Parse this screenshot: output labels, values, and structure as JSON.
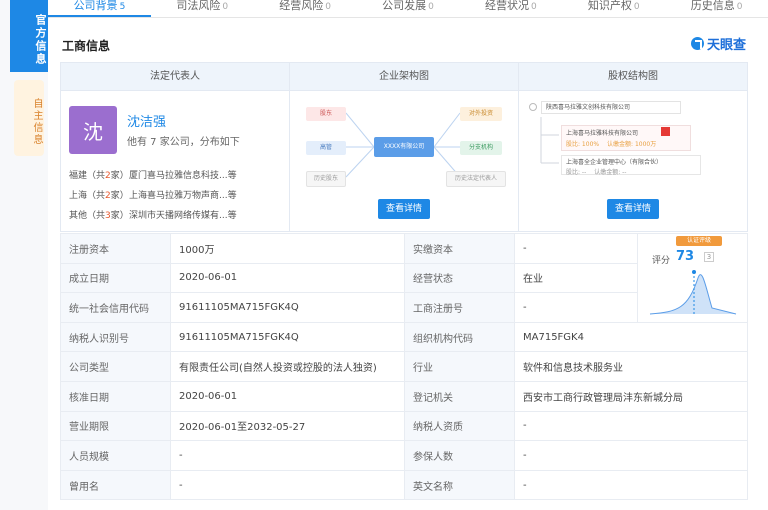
{
  "vtabs": {
    "official": "官方信息",
    "self": "自主信息"
  },
  "tabs": [
    {
      "label": "公司背景",
      "count": "5"
    },
    {
      "label": "司法风险",
      "count": "0"
    },
    {
      "label": "经营风险",
      "count": "0"
    },
    {
      "label": "公司发展",
      "count": "0"
    },
    {
      "label": "经营状况",
      "count": "0"
    },
    {
      "label": "知识产权",
      "count": "0"
    },
    {
      "label": "历史信息",
      "count": "0"
    }
  ],
  "section_title": "工商信息",
  "brand": "天眼查",
  "panel": {
    "headers": [
      "法定代表人",
      "企业架构图",
      "股权结构图"
    ],
    "legal": {
      "avatar_char": "沈",
      "name": "沈洁强",
      "summary": "他有 7 家公司，分布如下",
      "regions": [
        {
          "region": "福建",
          "count_prefix": "（共",
          "count": "2",
          "count_suffix": "家）",
          "company": "厦门喜马拉雅信息科技...等"
        },
        {
          "region": "上海",
          "count_prefix": "（共",
          "count": "2",
          "count_suffix": "家）",
          "company": "上海喜马拉雅万物声商...等"
        },
        {
          "region": "其他",
          "count_prefix": "（共",
          "count": "3",
          "count_suffix": "家）",
          "company": "深圳市天播网络传媒有...等"
        }
      ]
    },
    "arch": {
      "nodes": [
        "股东",
        "高管",
        "历史股东",
        "XXXX有限公司",
        "对外投资",
        "分支机构",
        "历史法定代表人"
      ],
      "button": "查看详情"
    },
    "equity": {
      "root": "陕西喜马拉雅文创科技有限公司",
      "child1": "上海喜马拉雅科技有限公司",
      "child1_ratio": "股比: 100%",
      "child1_amount": "认缴金额: 1000万",
      "child2": "上海喜全企业管理中心（有限合伙）",
      "child2_ratio": "股比: --",
      "child2_amount": "认缴金额: --",
      "button": "查看详情"
    }
  },
  "rating": {
    "badge": "认证评级",
    "label": "评分",
    "score": "73",
    "box": "3"
  },
  "rows": [
    {
      "k1": "注册资本",
      "v1": "1000万",
      "k2": "实缴资本",
      "v2": "-"
    },
    {
      "k1": "成立日期",
      "v1": "2020-06-01",
      "k2": "经营状态",
      "v2": "在业"
    },
    {
      "k1": "统一社会信用代码",
      "v1": "91611105MA715FGK4Q",
      "k2": "工商注册号",
      "v2": "-"
    },
    {
      "k1": "纳税人识别号",
      "v1": "91611105MA715FGK4Q",
      "k2": "组织机构代码",
      "v2": "MA715FGK4"
    },
    {
      "k1": "公司类型",
      "v1": "有限责任公司(自然人投资或控股的法人独资)",
      "k2": "行业",
      "v2": "软件和信息技术服务业"
    },
    {
      "k1": "核准日期",
      "v1": "2020-06-01",
      "k2": "登记机关",
      "v2": "西安市工商行政管理局沣东新城分局"
    },
    {
      "k1": "营业期限",
      "v1": "2020-06-01至2032-05-27",
      "k2": "纳税人资质",
      "v2": "-"
    },
    {
      "k1": "人员规模",
      "v1": "-",
      "k2": "参保人数",
      "v2": "-"
    },
    {
      "k1": "曾用名",
      "v1": "-",
      "k2": "英文名称",
      "v2": "-"
    }
  ]
}
